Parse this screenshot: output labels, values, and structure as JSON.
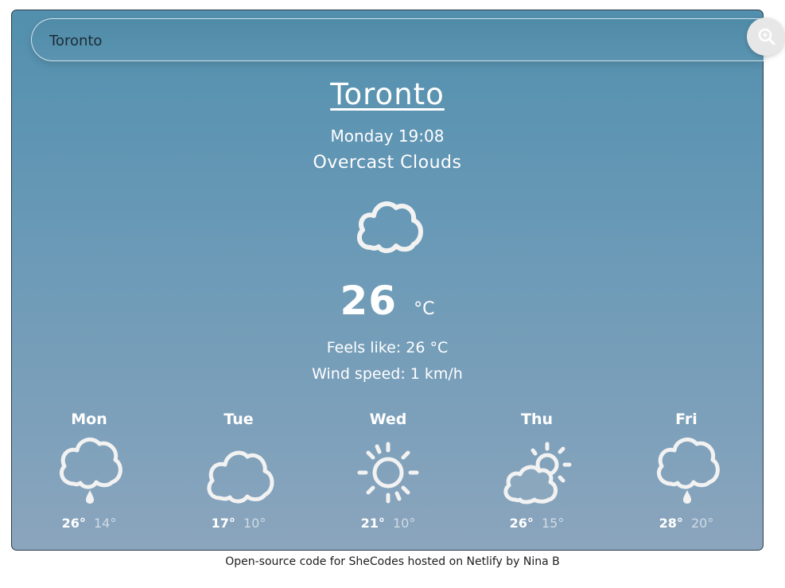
{
  "search": {
    "value": "Toronto",
    "button_icon": "search-icon"
  },
  "current": {
    "city": "Toronto",
    "date": "Monday 19:08",
    "description": "Overcast Clouds",
    "icon": "cloud-icon",
    "temperature": "26",
    "unit": "°C",
    "feels_like": "Feels like: 26 °C",
    "wind_speed": "Wind speed: 1 km/h"
  },
  "forecast": [
    {
      "day": "Mon",
      "icon": "rain-cloud-icon",
      "max": "26°",
      "min": "14°"
    },
    {
      "day": "Tue",
      "icon": "cloud-icon",
      "max": "17°",
      "min": "10°"
    },
    {
      "day": "Wed",
      "icon": "sun-icon",
      "max": "21°",
      "min": "10°"
    },
    {
      "day": "Thu",
      "icon": "partly-cloudy-icon",
      "max": "26°",
      "min": "15°"
    },
    {
      "day": "Fri",
      "icon": "rain-cloud-icon",
      "max": "28°",
      "min": "20°"
    }
  ],
  "footer": {
    "text": "Open-source code for SheCodes hosted on Netlify by Nina B"
  },
  "colors": {
    "card_top": "#5290ae",
    "card_bottom": "#8ba5bd",
    "icon_stroke": "#f2f2f2"
  }
}
